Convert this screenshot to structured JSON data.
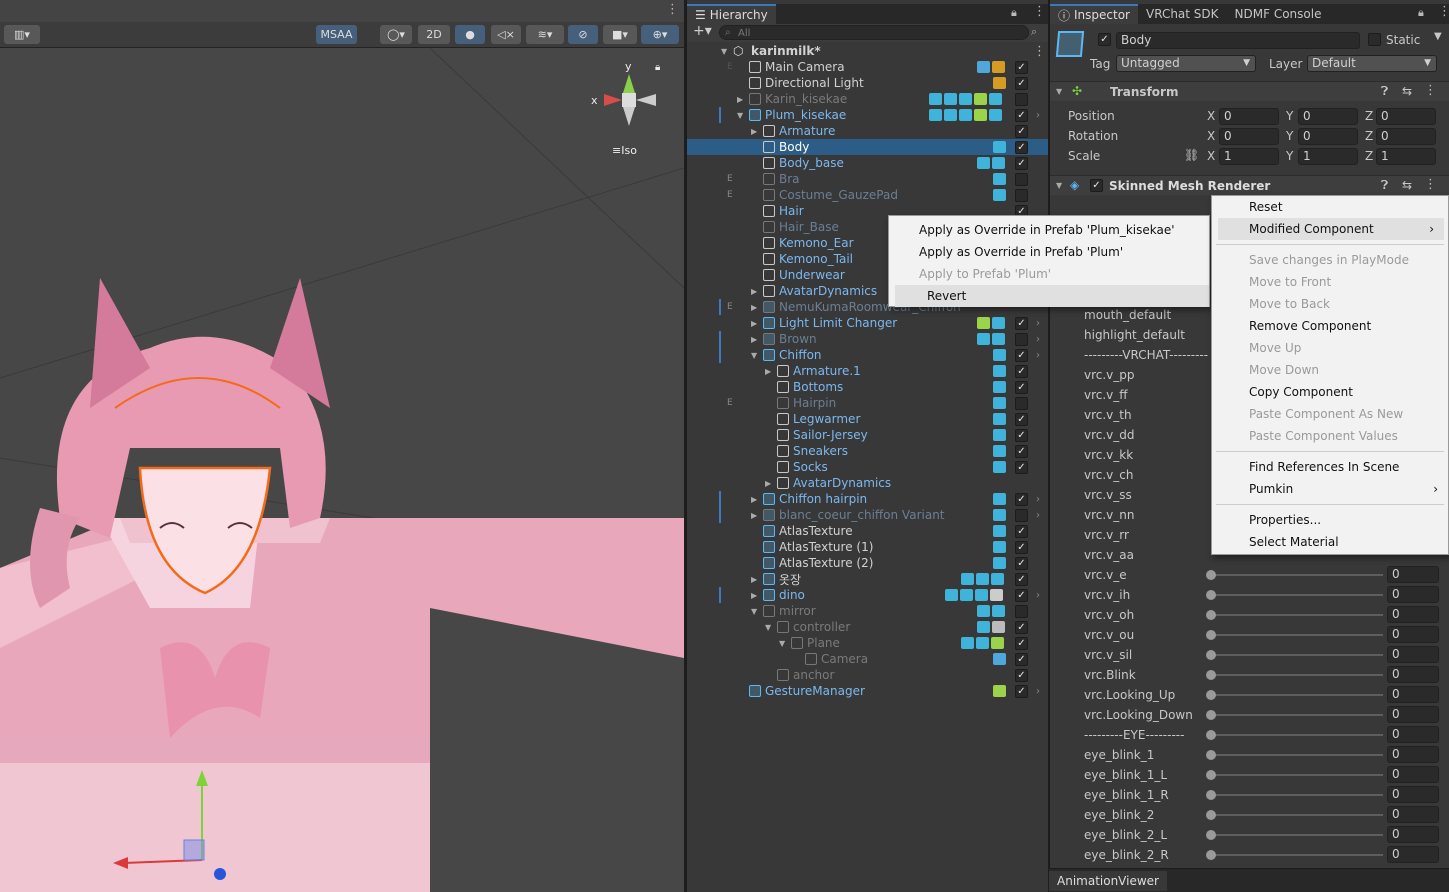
{
  "scene": {
    "toolbar": {
      "msaa": "MSAA",
      "mode2d": "2D"
    },
    "gizmo": {
      "y": "y",
      "x": "x",
      "projection": "Iso"
    }
  },
  "hierarchy": {
    "tab": "Hierarchy",
    "search_placeholder": "All",
    "root": "karinmilk*",
    "items": [
      {
        "label": "Main Camera"
      },
      {
        "label": "Directional Light"
      },
      {
        "label": "Karin_kisekae"
      },
      {
        "label": "Plum_kisekae"
      },
      {
        "label": "Armature"
      },
      {
        "label": "Body"
      },
      {
        "label": "Body_base"
      },
      {
        "label": "Bra"
      },
      {
        "label": "Costume_GauzePad"
      },
      {
        "label": "Hair"
      },
      {
        "label": "Hair_Base"
      },
      {
        "label": "Kemono_Ear"
      },
      {
        "label": "Kemono_Tail"
      },
      {
        "label": "Underwear"
      },
      {
        "label": "AvatarDynamics"
      },
      {
        "label": "NemuKumaRoomwear_Chiffon"
      },
      {
        "label": "Light Limit Changer"
      },
      {
        "label": "Brown"
      },
      {
        "label": "Chiffon"
      },
      {
        "label": "Armature.1"
      },
      {
        "label": "Bottoms"
      },
      {
        "label": "Hairpin"
      },
      {
        "label": "Legwarmer"
      },
      {
        "label": "Sailor-Jersey"
      },
      {
        "label": "Sneakers"
      },
      {
        "label": "Socks"
      },
      {
        "label": "AvatarDynamics"
      },
      {
        "label": "Chiffon hairpin"
      },
      {
        "label": "blanc_coeur_chiffon Variant"
      },
      {
        "label": "AtlasTexture"
      },
      {
        "label": "AtlasTexture (1)"
      },
      {
        "label": "AtlasTexture (2)"
      },
      {
        "label": "옷장"
      },
      {
        "label": "dino"
      },
      {
        "label": "mirror"
      },
      {
        "label": "controller"
      },
      {
        "label": "Plane"
      },
      {
        "label": "Camera"
      },
      {
        "label": "anchor"
      },
      {
        "label": "GestureManager"
      }
    ],
    "edge_marker": "E"
  },
  "inspector": {
    "tabs": [
      "Inspector",
      "VRChat SDK",
      "NDMF Console"
    ],
    "object_name": "Body",
    "static_label": "Static",
    "tag_label": "Tag",
    "tag_value": "Untagged",
    "layer_label": "Layer",
    "layer_value": "Default",
    "transform": {
      "title": "Transform",
      "rows": [
        {
          "label": "Position",
          "x": "0",
          "y": "0",
          "z": "0"
        },
        {
          "label": "Rotation",
          "x": "0",
          "y": "0",
          "z": "0"
        },
        {
          "label": "Scale",
          "x": "1",
          "y": "1",
          "z": "1"
        }
      ],
      "axes": [
        "X",
        "Y",
        "Z"
      ]
    },
    "smr_title": "Skinned Mesh Renderer",
    "blendshape_labels_upper": [
      "mouth_default",
      "highlight_default",
      "---------VRCHAT---------",
      "vrc.v_pp",
      "vrc.v_ff",
      "vrc.v_th",
      "vrc.v_dd",
      "vrc.v_kk",
      "vrc.v_ch",
      "vrc.v_ss",
      "vrc.v_nn",
      "vrc.v_rr",
      "vrc.v_aa"
    ],
    "blendshapes": [
      {
        "label": "vrc.v_e",
        "value": "0"
      },
      {
        "label": "vrc.v_ih",
        "value": "0"
      },
      {
        "label": "vrc.v_oh",
        "value": "0"
      },
      {
        "label": "vrc.v_ou",
        "value": "0"
      },
      {
        "label": "vrc.v_sil",
        "value": "0"
      },
      {
        "label": "vrc.Blink",
        "value": "0"
      },
      {
        "label": "vrc.Looking_Up",
        "value": "0"
      },
      {
        "label": "vrc.Looking_Down",
        "value": "0"
      },
      {
        "label": "---------EYE---------",
        "value": "0"
      },
      {
        "label": "eye_blink_1",
        "value": "0"
      },
      {
        "label": "eye_blink_1_L",
        "value": "0"
      },
      {
        "label": "eye_blink_1_R",
        "value": "0"
      },
      {
        "label": "eye_blink_2",
        "value": "0"
      },
      {
        "label": "eye_blink_2_L",
        "value": "0"
      },
      {
        "label": "eye_blink_2_R",
        "value": "0"
      }
    ]
  },
  "prefab_menu": {
    "items": [
      {
        "label": "Apply as Override in Prefab 'Plum_kisekae'"
      },
      {
        "label": "Apply as Override in Prefab 'Plum'"
      },
      {
        "label": "Apply to Prefab 'Plum'"
      },
      {
        "label": "Revert"
      }
    ]
  },
  "context_menu": {
    "items": [
      {
        "label": "Reset"
      },
      {
        "label": "Modified Component"
      },
      {
        "label": "Save changes in PlayMode"
      },
      {
        "label": "Move to Front"
      },
      {
        "label": "Move to Back"
      },
      {
        "label": "Remove Component"
      },
      {
        "label": "Move Up"
      },
      {
        "label": "Move Down"
      },
      {
        "label": "Copy Component"
      },
      {
        "label": "Paste Component As New"
      },
      {
        "label": "Paste Component Values"
      },
      {
        "label": "Find References In Scene"
      },
      {
        "label": "Pumkin"
      },
      {
        "label": "Properties..."
      },
      {
        "label": "Select Material"
      }
    ],
    "submenu_arrow": "›"
  },
  "bottom_tab": "AnimationViewer",
  "colors": {
    "accent": "#3a79bb",
    "prefab_blue": "#7bb8f0",
    "selection": "#2c5d87"
  }
}
